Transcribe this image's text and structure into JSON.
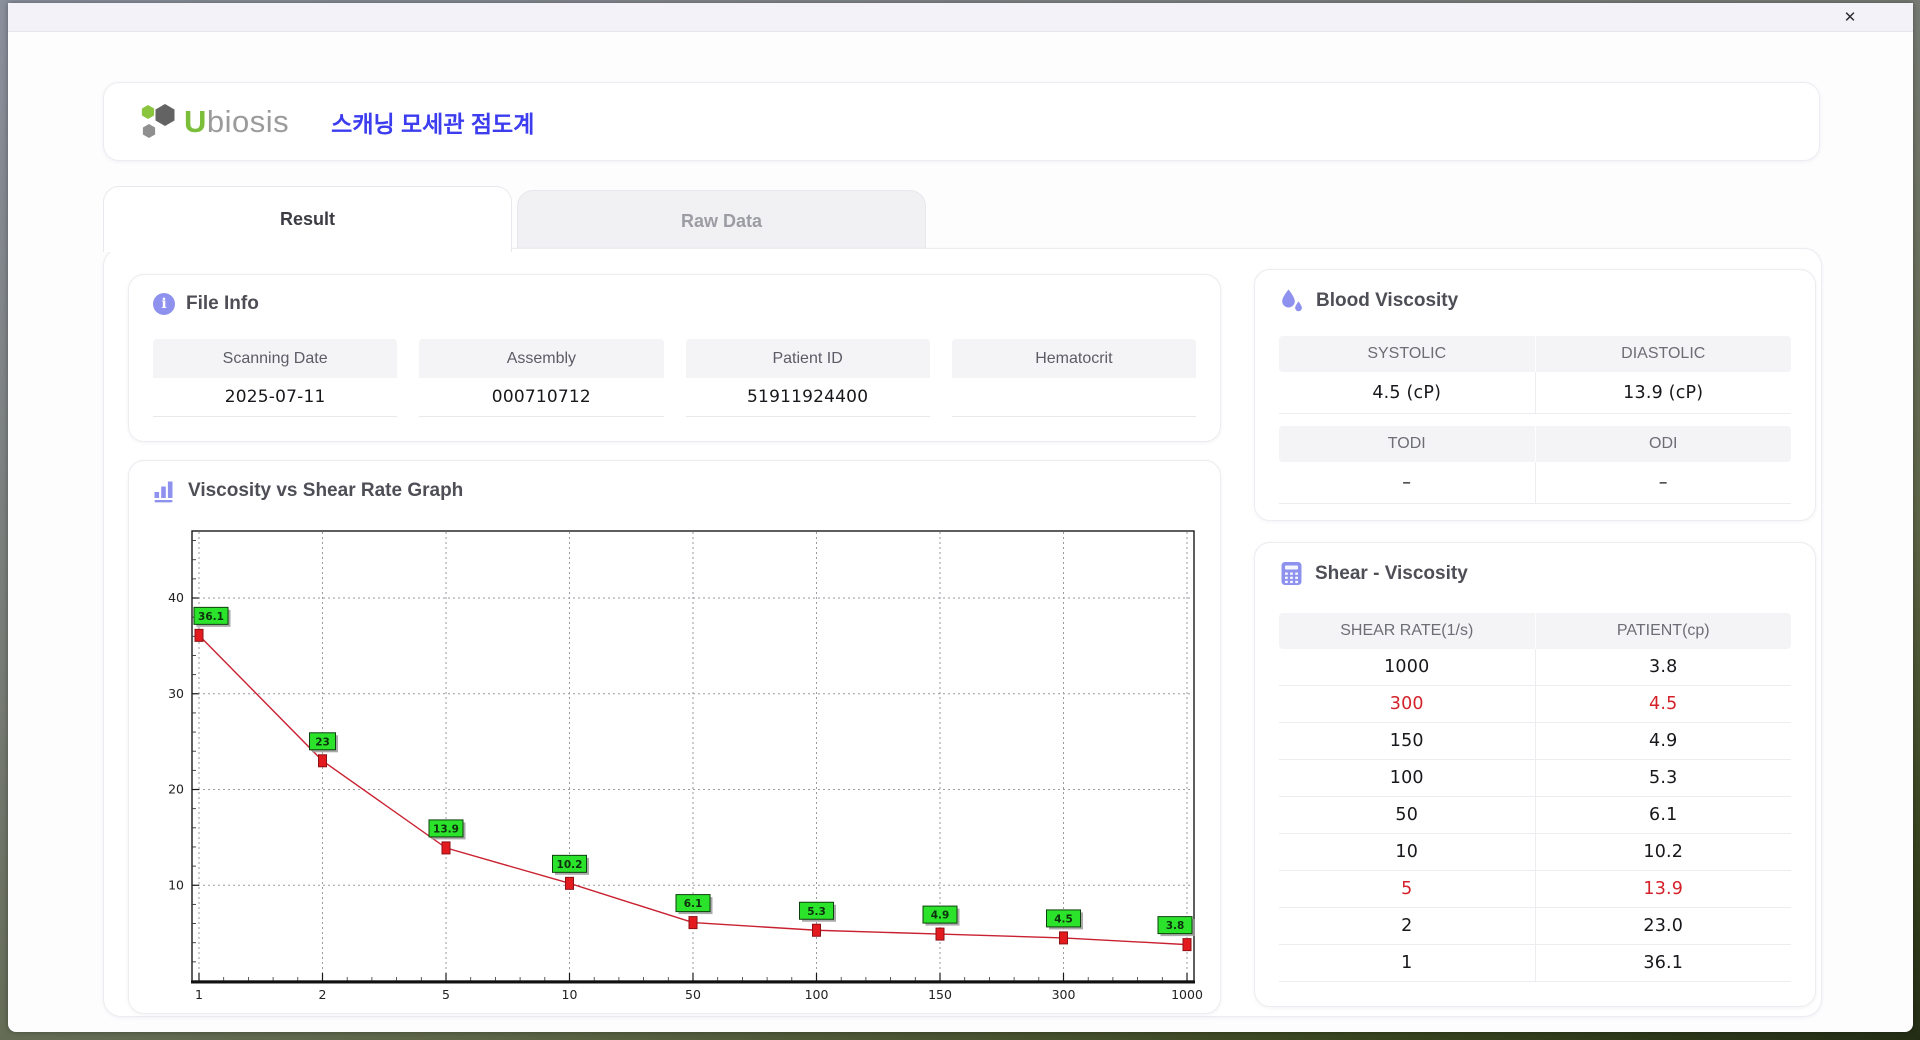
{
  "window": {
    "close_glyph": "✕"
  },
  "header": {
    "brand_u": "U",
    "brand_rest": "biosis",
    "app_title_korean": "스캐닝 모세관 점도계"
  },
  "tabs": [
    {
      "label": "Result",
      "active": true
    },
    {
      "label": "Raw Data",
      "active": false
    }
  ],
  "file_info": {
    "title": "File Info",
    "fields": [
      {
        "label": "Scanning Date",
        "value": "2025-07-11"
      },
      {
        "label": "Assembly",
        "value": "000710712"
      },
      {
        "label": "Patient ID",
        "value": "51911924400"
      },
      {
        "label": "Hematocrit",
        "value": ""
      }
    ]
  },
  "blood_viscosity": {
    "title": "Blood Viscosity",
    "groups": [
      {
        "labels": [
          "SYSTOLIC",
          "DIASTOLIC"
        ],
        "values": [
          "4.5 (cP)",
          "13.9 (cP)"
        ]
      },
      {
        "labels": [
          "TODI",
          "ODI"
        ],
        "values": [
          "–",
          "–"
        ]
      }
    ]
  },
  "shear_viscosity": {
    "title": "Shear - Viscosity",
    "columns": [
      "SHEAR RATE(1/s)",
      "PATIENT(cp)"
    ],
    "rows": [
      {
        "rate": "1000",
        "cp": "3.8",
        "highlight": false
      },
      {
        "rate": "300",
        "cp": "4.5",
        "highlight": true
      },
      {
        "rate": "150",
        "cp": "4.9",
        "highlight": false
      },
      {
        "rate": "100",
        "cp": "5.3",
        "highlight": false
      },
      {
        "rate": "50",
        "cp": "6.1",
        "highlight": false
      },
      {
        "rate": "10",
        "cp": "10.2",
        "highlight": false
      },
      {
        "rate": "5",
        "cp": "13.9",
        "highlight": true
      },
      {
        "rate": "2",
        "cp": "23.0",
        "highlight": false
      },
      {
        "rate": "1",
        "cp": "36.1",
        "highlight": false
      }
    ]
  },
  "chart_data": {
    "type": "line",
    "title": "Viscosity vs Shear Rate Graph",
    "x": [
      1,
      2,
      5,
      10,
      50,
      100,
      150,
      300,
      1000
    ],
    "x_tick_labels": [
      "1",
      "2",
      "5",
      "10",
      "50",
      "100",
      "150",
      "300",
      "1000"
    ],
    "values": [
      36.1,
      23,
      13.9,
      10.2,
      6.1,
      5.3,
      4.9,
      4.5,
      3.8
    ],
    "point_labels": [
      "36.1",
      "23",
      "13.9",
      "10.2",
      "6.1",
      "5.3",
      "4.9",
      "4.5",
      "3.8"
    ],
    "xlabel": "",
    "ylabel": "",
    "y_ticks": [
      10,
      20,
      30,
      40
    ],
    "ylim": [
      0,
      47
    ],
    "x_scale": "categorical-equal-spacing",
    "grid": "dashed",
    "legend": "none",
    "line_color": "#c92131",
    "marker_color": "#e31b1f",
    "label_bg": "#2ce32c"
  },
  "icons": {
    "file_info": "info-icon",
    "graph": "bar-chart-icon",
    "blood_viscosity": "droplets-icon",
    "shear_viscosity": "calculator-icon",
    "close": "close-icon"
  },
  "colors": {
    "accent": "#8e92ee",
    "korean_title": "#3d3df0",
    "logo_green": "#7abe39",
    "logo_gray": "#9b9b9b",
    "highlight_red": "#d4222a"
  }
}
